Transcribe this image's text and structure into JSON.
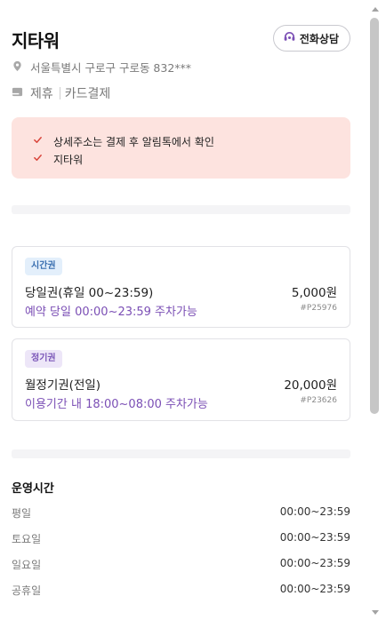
{
  "lot": {
    "name": "지타워",
    "address": "서울특별시 구로구 구로동 832***",
    "tags": [
      "제휴",
      "카드결제"
    ],
    "call_label": "전화상담"
  },
  "notice": {
    "items": [
      "상세주소는 결제 후 알림톡에서 확인",
      "지타워"
    ]
  },
  "tickets": [
    {
      "badge": "시간권",
      "name": "당일권(휴일 00~23:59)",
      "price": "5,000원",
      "desc": "예약 당일 00:00~23:59 주차가능",
      "code": "#P25976"
    },
    {
      "badge": "정기권",
      "name": "월정기권(전일)",
      "price": "20,000원",
      "desc": "이용기간 내 18:00~08:00 주차가능",
      "code": "#P23626"
    }
  ],
  "hours": {
    "title": "운영시간",
    "rows": [
      {
        "day": "평일",
        "time": "00:00~23:59"
      },
      {
        "day": "토요일",
        "time": "00:00~23:59"
      },
      {
        "day": "일요일",
        "time": "00:00~23:59"
      },
      {
        "day": "공휴일",
        "time": "00:00~23:59"
      }
    ]
  },
  "colors": {
    "accent_purple": "#7b4fb5",
    "notice_bg": "#fde3df",
    "check_red": "#d9443a",
    "badge_blue": "#3a6fb0"
  },
  "icons": {
    "call": "headset-icon",
    "address": "location-pin-icon",
    "tags": "card-icon",
    "notice": "check-icon"
  }
}
